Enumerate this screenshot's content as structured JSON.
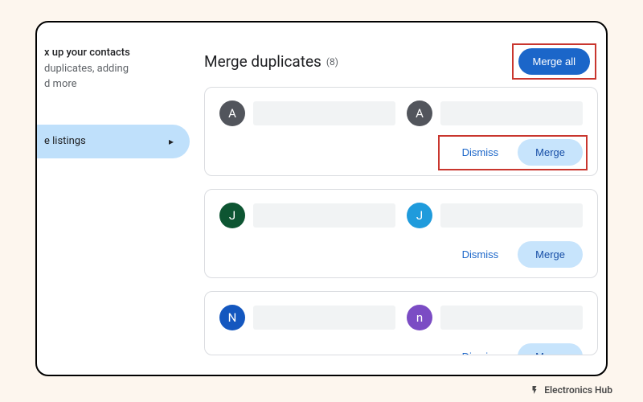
{
  "sidebar": {
    "heading_line1": "x up your contacts",
    "heading_line2": "duplicates, adding",
    "heading_line3": "d more",
    "selected_item_label": "e listings"
  },
  "header": {
    "title": "Merge duplicates",
    "count_display": "(8)",
    "merge_all_label": "Merge all"
  },
  "labels": {
    "dismiss": "Dismiss",
    "merge": "Merge"
  },
  "cards": [
    {
      "highlighted": true,
      "a": {
        "letter": "A",
        "color": "#52555c"
      },
      "b": {
        "letter": "A",
        "color": "#52555c"
      }
    },
    {
      "highlighted": false,
      "a": {
        "letter": "J",
        "color": "#0d5532"
      },
      "b": {
        "letter": "J",
        "color": "#1f9bdc"
      }
    },
    {
      "highlighted": false,
      "cut": true,
      "a": {
        "letter": "N",
        "color": "#1457bf"
      },
      "b": {
        "letter": "n",
        "color": "#7b4cc4"
      }
    }
  ],
  "watermark": {
    "text": "Electronics Hub"
  }
}
